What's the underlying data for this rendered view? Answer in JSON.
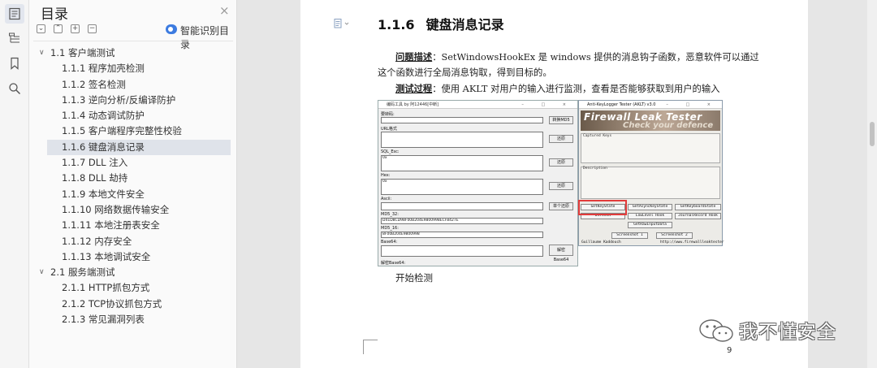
{
  "rail": {
    "icons": [
      "toc-icon",
      "structure-icon",
      "bookmark-icon",
      "search-icon"
    ]
  },
  "toc": {
    "title": "目录",
    "close": "×",
    "buttons": [
      "⌄",
      "⌃",
      "+",
      "−"
    ],
    "ai_label": "智能识别目录",
    "items": [
      {
        "label": "1.1 客户端测试",
        "level": 1,
        "expanded": true
      },
      {
        "label": "1.1.1 程序加壳检测",
        "level": 2
      },
      {
        "label": "1.1.2 签名检测",
        "level": 2
      },
      {
        "label": "1.1.3 逆向分析/反编译防护",
        "level": 2
      },
      {
        "label": "1.1.4 动态调试防护",
        "level": 2
      },
      {
        "label": "1.1.5 客户端程序完整性校验",
        "level": 2
      },
      {
        "label": "1.1.6 键盘消息记录",
        "level": 2,
        "selected": true
      },
      {
        "label": "1.1.7 DLL 注入",
        "level": 2
      },
      {
        "label": "1.1.8 DLL 劫持",
        "level": 2
      },
      {
        "label": "1.1.9 本地文件安全",
        "level": 2
      },
      {
        "label": "1.1.10 网络数据传输安全",
        "level": 2
      },
      {
        "label": "1.1.11 本地注册表安全",
        "level": 2
      },
      {
        "label": "1.1.12 内存安全",
        "level": 2
      },
      {
        "label": "1.1.13 本地调试安全",
        "level": 2
      },
      {
        "label": "2.1 服务端测试",
        "level": 1,
        "expanded": true
      },
      {
        "label": "2.1.1 HTTP抓包方式",
        "level": 2
      },
      {
        "label": "2.1.2 TCP协议抓包方式",
        "level": 2
      },
      {
        "label": "2.1.3 常见漏洞列表",
        "level": 2
      }
    ]
  },
  "document": {
    "heading_num": "1.1.6",
    "heading_text": "键盘消息记录",
    "p1_label": "问题描述",
    "p1_text": "：SetWindowsHookEx 是 windows 提供的消息钩子函数，恶意软件可以通过",
    "p1_cont": "这个函数进行全局消息钩取，得到目标的。",
    "p2_label": "测试过程",
    "p2_text": "：使用 AKLT 对用户的输入进行监测，查看是否能够获取到用户的输入",
    "caption": "开始检测",
    "page_number": "9"
  },
  "shot": {
    "win1": {
      "title": "编码工具 by 阿12446[中断]",
      "labels": [
        "要转码:",
        "URL格式",
        "SQL_Esc:",
        "Hex:",
        "Ascii:",
        "MD5_32:",
        "MD5_16:",
        "Base64:",
        "解密Base64:"
      ],
      "values": [
        "0x",
        "0x",
        "D41D8CD98F00B204E9800998ECF8427E",
        "8F00B204E9800998"
      ],
      "buttons": [
        "转换MD5",
        "还原",
        "还原",
        "还原",
        "单个还原",
        "解密Base64"
      ]
    },
    "win2": {
      "title": "Anti-KeyLogger Tester (AKLT) v3.0",
      "banner1": "Firewall Leak Tester",
      "banner2": "Check your defence",
      "captured": "Captured Keys",
      "description": "Description",
      "buttons": [
        "GetKeyState",
        "GetAsyncKeyState",
        "GetKeyboardState",
        "DirectX",
        "LowLevel Hook",
        "JournalRecord Hook",
        "GetRawInputData",
        "Screenshot 1",
        "Screenshot 2"
      ],
      "author": "Guillaume Kaddouch",
      "url": "http://www.firewallleaktester"
    }
  },
  "watermark": {
    "text": "我不懂安全"
  },
  "colors": {
    "accent": "#3c7be0",
    "highlight": "#e23b3b",
    "selected_bg": "#dfe3ea"
  }
}
